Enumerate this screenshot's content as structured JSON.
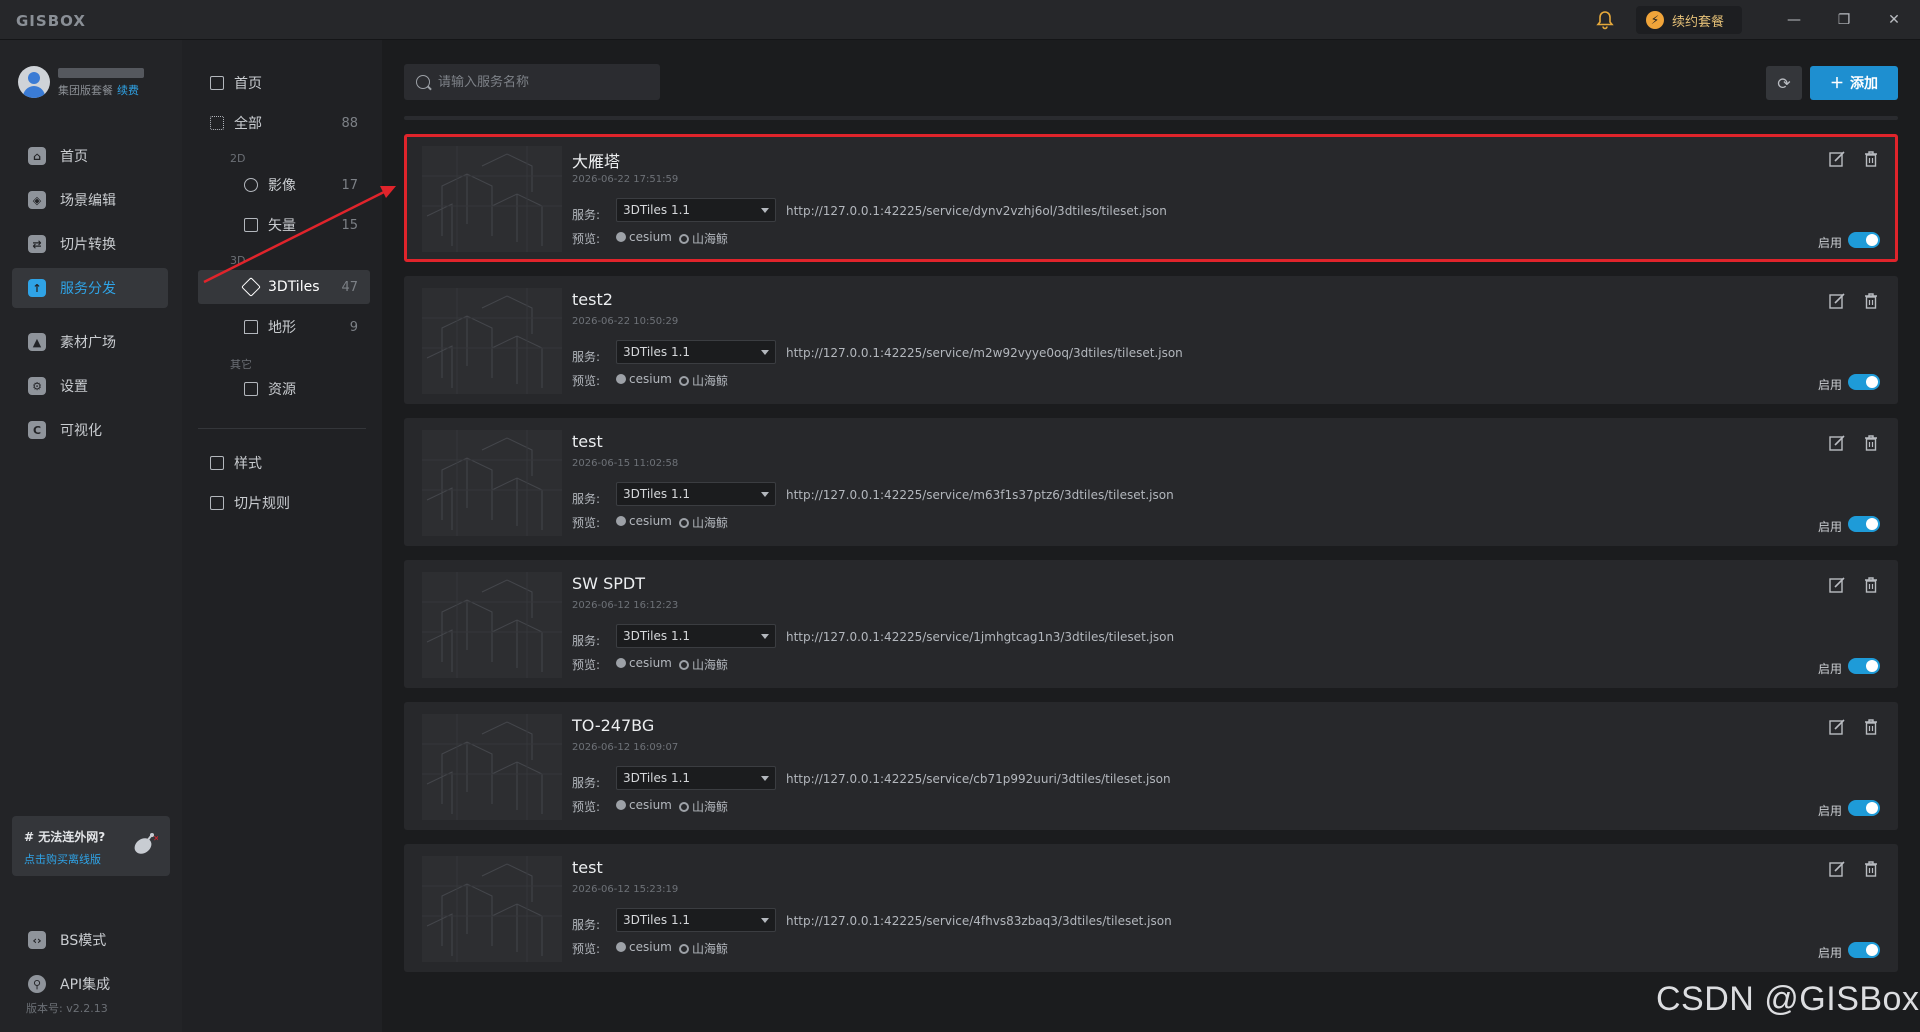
{
  "app": {
    "logo": "GISBOX"
  },
  "titlebar": {
    "renew_label": "续约套餐",
    "minimize": "—",
    "maximize": "❐",
    "close": "✕"
  },
  "user": {
    "plan": "集团版套餐",
    "renew_link": "续费"
  },
  "nav": {
    "items": [
      {
        "label": "首页",
        "icon": "home-icon"
      },
      {
        "label": "场景编辑",
        "icon": "scene-edit-icon"
      },
      {
        "label": "切片转换",
        "icon": "slice-convert-icon"
      },
      {
        "label": "服务分发",
        "icon": "service-distribute-icon",
        "active": true
      },
      {
        "label": "素材广场",
        "icon": "material-icon"
      },
      {
        "label": "设置",
        "icon": "settings-icon"
      },
      {
        "label": "可视化",
        "icon": "visualize-icon"
      }
    ],
    "bottom": [
      {
        "label": "BS模式",
        "icon": "bs-mode-icon"
      },
      {
        "label": "API集成",
        "icon": "api-icon"
      }
    ]
  },
  "offline": {
    "title": "# 无法连外网?",
    "link": "点击购买离线版"
  },
  "version": "版本号: v2.2.13",
  "subnav": {
    "home": "首页",
    "all": {
      "label": "全部",
      "count": "88"
    },
    "group2d": "2D",
    "image": {
      "label": "影像",
      "count": "17"
    },
    "vector": {
      "label": "矢量",
      "count": "15"
    },
    "group3d": "3D",
    "tiles3d": {
      "label": "3DTiles",
      "count": "47"
    },
    "terrain": {
      "label": "地形",
      "count": "9"
    },
    "groupOther": "其它",
    "resource": {
      "label": "资源"
    },
    "style": "样式",
    "rule": "切片规则"
  },
  "toolbar": {
    "search_placeholder": "请输入服务名称",
    "add_label": "添加"
  },
  "labels": {
    "service": "服务:",
    "preview": "预览:",
    "cesium": "cesium",
    "shanhai": "山海鲸",
    "enable": "启用"
  },
  "cards": [
    {
      "name": "大雁塔",
      "date": "2026-06-22 17:51:59",
      "version": "3DTiles 1.1",
      "url": "http://127.0.0.1:42225/service/dynv2vzhj6ol/3dtiles/tileset.json"
    },
    {
      "name": "test2",
      "date": "2026-06-22 10:50:29",
      "version": "3DTiles 1.1",
      "url": "http://127.0.0.1:42225/service/m2w92vyye0oq/3dtiles/tileset.json"
    },
    {
      "name": "test",
      "date": "2026-06-15 11:02:58",
      "version": "3DTiles 1.1",
      "url": "http://127.0.0.1:42225/service/m63f1s37ptz6/3dtiles/tileset.json"
    },
    {
      "name": "SW SPDT",
      "date": "2026-06-12 16:12:23",
      "version": "3DTiles 1.1",
      "url": "http://127.0.0.1:42225/service/1jmhgtcag1n3/3dtiles/tileset.json"
    },
    {
      "name": "TO-247BG",
      "date": "2026-06-12 16:09:07",
      "version": "3DTiles 1.1",
      "url": "http://127.0.0.1:42225/service/cb71p992uuri/3dtiles/tileset.json"
    },
    {
      "name": "test",
      "date": "2026-06-12 15:23:19",
      "version": "3DTiles 1.1",
      "url": "http://127.0.0.1:42225/service/4fhvs83zbaq3/3dtiles/tileset.json"
    }
  ],
  "watermark": "CSDN @GISBox",
  "colors": {
    "accent": "#1e8fd0",
    "highlight": "#e0242b"
  }
}
